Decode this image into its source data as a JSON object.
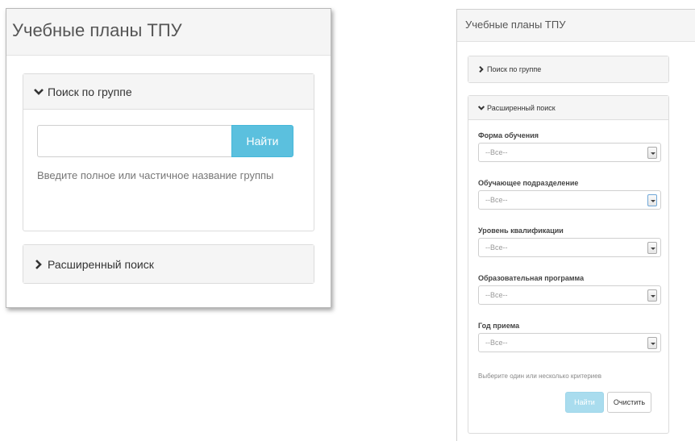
{
  "left": {
    "title": "Учебные планы ТПУ",
    "group_search": {
      "header": "Поиск по группе",
      "input_value": "",
      "button_label": "Найти",
      "hint": "Введите полное или частичное название группы"
    },
    "advanced_search": {
      "header": "Расширенный поиск"
    }
  },
  "right": {
    "title": "Учебные планы ТПУ",
    "group_search": {
      "header": "Поиск по группе"
    },
    "advanced_search": {
      "header": "Расширенный поиск",
      "fields": [
        {
          "label": "Форма обучения",
          "value": "--Все--"
        },
        {
          "label": "Обучающее подразделение",
          "value": "--Все--"
        },
        {
          "label": "Уровень квалификации",
          "value": "--Все--"
        },
        {
          "label": "Образовательная программа",
          "value": "--Все--"
        },
        {
          "label": "Год приема",
          "value": "--Все--"
        }
      ],
      "hint": "Выберите один или несколько критериев",
      "find_label": "Найти",
      "clear_label": "Очистить"
    }
  }
}
